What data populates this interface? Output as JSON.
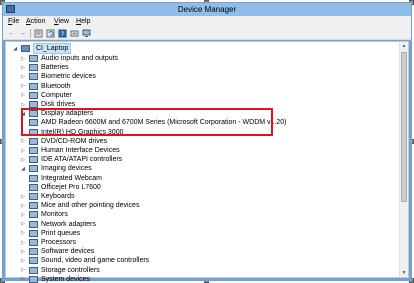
{
  "window": {
    "title": "Device Manager"
  },
  "menu": [
    {
      "underline": "F",
      "rest": "ile"
    },
    {
      "underline": "A",
      "rest": "ction"
    },
    {
      "underline": "V",
      "rest": "iew"
    },
    {
      "underline": "H",
      "rest": "elp"
    }
  ],
  "toolbar": {
    "back_glyph": "←",
    "forward_glyph": "→",
    "icons": [
      "properties-icon",
      "refresh-icon",
      "help-icon",
      "scan-icon",
      "monitor-icon"
    ]
  },
  "tree": {
    "root": "CI_Laptop",
    "items": [
      {
        "label": "Audio inputs and outputs",
        "level": 1,
        "expanded": false
      },
      {
        "label": "Batteries",
        "level": 1,
        "expanded": false
      },
      {
        "label": "Biometric devices",
        "level": 1,
        "expanded": false
      },
      {
        "label": "Bluetooth",
        "level": 1,
        "expanded": false
      },
      {
        "label": "Computer",
        "level": 1,
        "expanded": false
      },
      {
        "label": "Disk drives",
        "level": 1,
        "expanded": false
      },
      {
        "label": "Display adapters",
        "level": 1,
        "expanded": true
      },
      {
        "label": "AMD Radeon 6600M and 6700M Series (Microsoft Corporation - WDDM v1.20)",
        "level": 2
      },
      {
        "label": "Intel(R) HD Graphics 3000",
        "level": 2
      },
      {
        "label": "DVD/CD-ROM drives",
        "level": 1,
        "expanded": false
      },
      {
        "label": "Human Interface Devices",
        "level": 1,
        "expanded": false
      },
      {
        "label": "IDE ATA/ATAPI controllers",
        "level": 1,
        "expanded": false
      },
      {
        "label": "Imaging devices",
        "level": 1,
        "expanded": true
      },
      {
        "label": "Integrated Webcam",
        "level": 2
      },
      {
        "label": "Officejet Pro L7600",
        "level": 2
      },
      {
        "label": "Keyboards",
        "level": 1,
        "expanded": false
      },
      {
        "label": "Mice and other pointing devices",
        "level": 1,
        "expanded": false
      },
      {
        "label": "Monitors",
        "level": 1,
        "expanded": false
      },
      {
        "label": "Network adapters",
        "level": 1,
        "expanded": false
      },
      {
        "label": "Print queues",
        "level": 1,
        "expanded": false
      },
      {
        "label": "Processors",
        "level": 1,
        "expanded": false
      },
      {
        "label": "Software devices",
        "level": 1,
        "expanded": false
      },
      {
        "label": "Sound, video and game controllers",
        "level": 1,
        "expanded": false
      },
      {
        "label": "Storage controllers",
        "level": 1,
        "expanded": false
      },
      {
        "label": "System devices",
        "level": 1,
        "expanded": false
      }
    ]
  },
  "colors": {
    "highlight_border": "#e0121c",
    "titlebar": "#8fbde8",
    "selection": "#cce4f7"
  }
}
